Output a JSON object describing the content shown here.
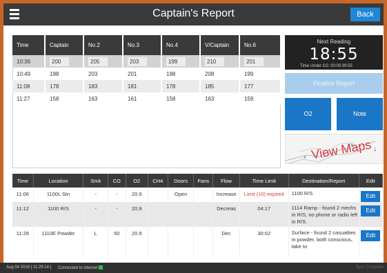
{
  "header": {
    "title": "Captain's Report",
    "back_label": "Back"
  },
  "readings_table": {
    "columns": [
      "Time",
      "Captain",
      "No.2",
      "No.3",
      "No.4",
      "V/Captain",
      "No.6"
    ],
    "rows": [
      [
        "10:36",
        "200",
        "205",
        "203",
        "199",
        "210",
        "201"
      ],
      [
        "10:49",
        "198",
        "203",
        "201",
        "198",
        "208",
        "199"
      ],
      [
        "11:08",
        "178",
        "183",
        "181",
        "178",
        "185",
        "177"
      ],
      [
        "11:27",
        "158",
        "163",
        "161",
        "158",
        "163",
        "159"
      ]
    ]
  },
  "next_reading": {
    "label": "Next Reading",
    "time": "18:55",
    "under_o2": "Time Under O2: 00:00:39:55"
  },
  "actions": {
    "finalize_label": "Finalize Report",
    "o2_label": "O2",
    "note_label": "Note",
    "maps_label": "View Maps"
  },
  "log_table": {
    "columns": [
      "Time",
      "Location",
      "Smk",
      "CO",
      "O2",
      "CH4",
      "Doors",
      "Fans",
      "Flow",
      "Time Limit",
      "Destination/Report",
      "Edit"
    ],
    "rows": [
      [
        "11:06",
        "1100L Stn",
        "-",
        "-",
        "20.9",
        "",
        "Open",
        "",
        "Increase",
        "Limit (10) expired",
        "1100 R/S",
        "Edit"
      ],
      [
        "11:12",
        "1100 R/S",
        "-",
        "-",
        "20.9",
        "",
        "",
        "",
        "Decreas",
        "04:17",
        "1114 Ramp - found 2 mechs in R/S, no phone or radio left in R/S.",
        "Edit"
      ],
      [
        "11:28",
        "1110E Powder",
        "L",
        "50",
        "20.9",
        "",
        "",
        "",
        "Dec",
        "30:02",
        "Surface - found 2 casualties in powder, both conscious, take to",
        "Edit"
      ]
    ]
  },
  "status": {
    "datetime": "Aug 04 2016 [ 11:29:14 ]",
    "connection": "Connected to internet",
    "sync": "Sync Complete"
  },
  "colors": {
    "accent_blue": "#1a76c6",
    "header_dark": "#3a3a3a",
    "frame_orange": "#c8662a",
    "alert_red": "#d23b3b",
    "status_green": "#2fbf3f"
  },
  "icons": {
    "menu": "hamburger-icon",
    "status": "connection-status-dot",
    "maps_arrow": "arrow-down-icon"
  }
}
